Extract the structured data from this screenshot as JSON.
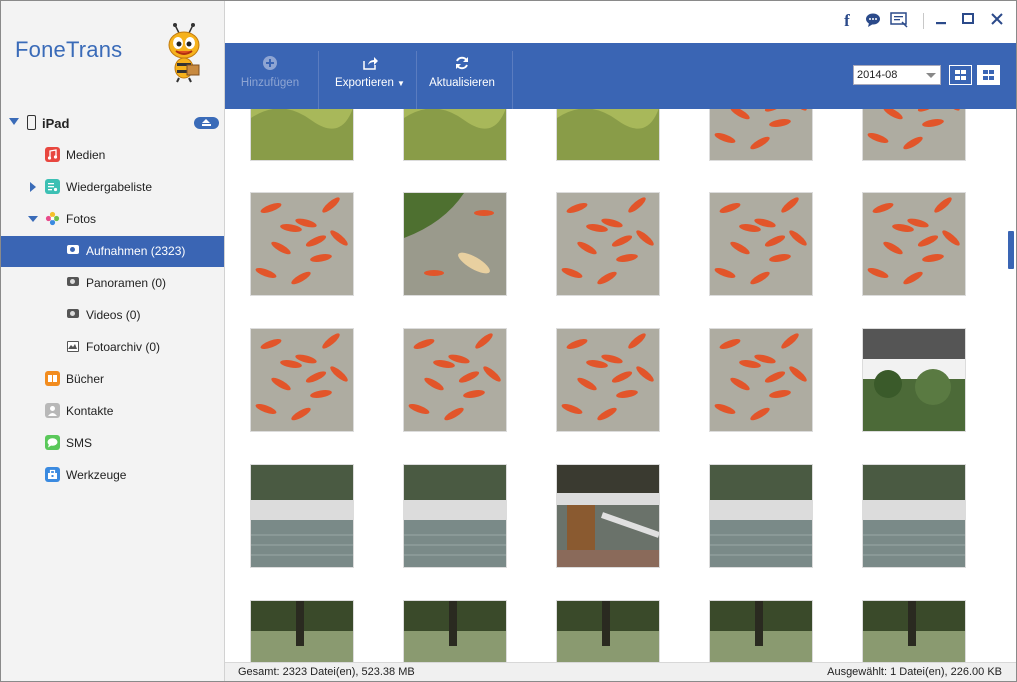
{
  "app": {
    "title": "FoneTrans"
  },
  "device": {
    "name": "iPad"
  },
  "sidebar": {
    "items": [
      {
        "label": "Medien",
        "icon": "music-icon",
        "color": "#e8473f"
      },
      {
        "label": "Wiedergabeliste",
        "icon": "playlist-icon",
        "color": "#3cc0b4"
      },
      {
        "label": "Fotos",
        "icon": "photos-icon",
        "color": "#f0a020"
      },
      {
        "label": "Aufnahmen (2323)",
        "icon": "camera-icon",
        "selected": true
      },
      {
        "label": "Panoramen (0)",
        "icon": "camera-icon"
      },
      {
        "label": "Videos (0)",
        "icon": "camera-icon"
      },
      {
        "label": "Fotoarchiv (0)",
        "icon": "photo-library-icon"
      },
      {
        "label": "Bücher",
        "icon": "books-icon",
        "color": "#f28c1e"
      },
      {
        "label": "Kontakte",
        "icon": "contacts-icon",
        "color": "#9a9a9a"
      },
      {
        "label": "SMS",
        "icon": "message-icon",
        "color": "#5ac85a"
      },
      {
        "label": "Werkzeuge",
        "icon": "toolbox-icon",
        "color": "#3a8ae0"
      }
    ]
  },
  "toolbar": {
    "add_label": "Hinzufügen",
    "export_label": "Exportieren",
    "refresh_label": "Aktualisieren",
    "date_value": "2014-08"
  },
  "status": {
    "total": "Gesamt: 2323 Datei(en), 523.38 MB",
    "selected": "Ausgewählt: 1 Datei(en), 226.00 KB"
  },
  "colors": {
    "accent": "#3a65b4",
    "brand": "#3a6bb8"
  },
  "thumbnails": [
    "grass",
    "grass",
    "grass",
    "koi",
    "koi",
    "koi",
    "koi-pond",
    "koi",
    "koi",
    "koi",
    "koi",
    "koi",
    "koi",
    "koi",
    "trees",
    "waterfall",
    "waterfall",
    "waterfall-bin",
    "waterfall",
    "waterfall",
    "ducks",
    "ducks",
    "ducks",
    "ducks",
    "ducks"
  ]
}
